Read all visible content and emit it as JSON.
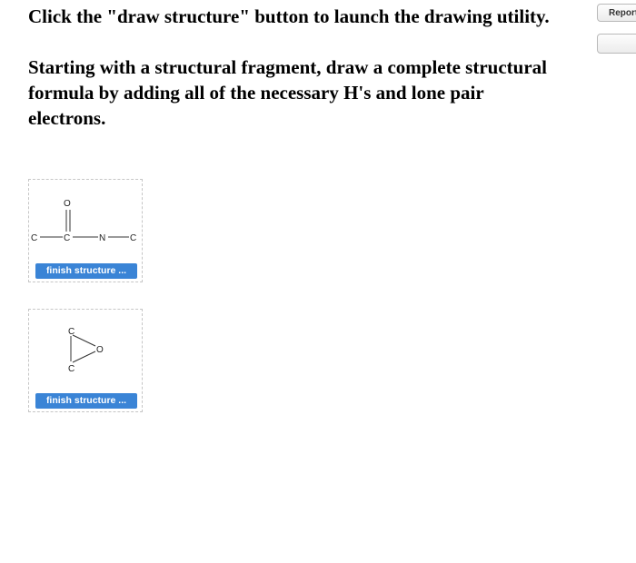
{
  "instructions": {
    "line1": "Click the \"draw structure\" button to launch the drawing utility.",
    "line2": "Starting with a structural fragment, draw a complete structural formula by adding all of the necessary H's and lone pair electrons."
  },
  "toolbar": {
    "report_label": "Report"
  },
  "structures": [
    {
      "atoms": {
        "c1": "C",
        "c2": "C",
        "o": "O",
        "n": "N",
        "c3": "C"
      },
      "button_label": "finish structure ..."
    },
    {
      "atoms": {
        "c1": "C",
        "c2": "C",
        "o": "O"
      },
      "button_label": "finish structure ..."
    }
  ]
}
